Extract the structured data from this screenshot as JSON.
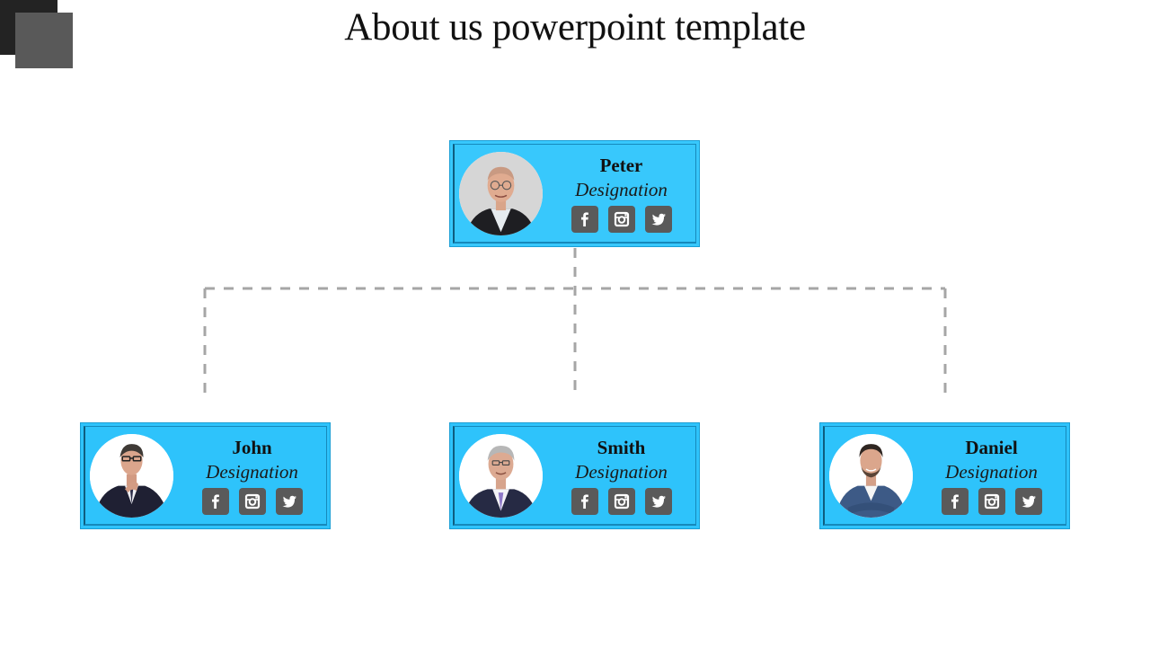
{
  "slide": {
    "title": "About us powerpoint template",
    "colors": {
      "card_fill": "#2ec3fb",
      "card_border": "#1a9fd6",
      "icon_bg": "#5a5a5a",
      "connector": "#a6a6a6",
      "deco_dark": "#232323",
      "deco_light": "#595959"
    }
  },
  "top": {
    "name": "Peter",
    "designation": "Designation",
    "socials": [
      "facebook-icon",
      "instagram-icon",
      "twitter-icon"
    ]
  },
  "members": [
    {
      "name": "John",
      "designation": "Designation",
      "socials": [
        "facebook-icon",
        "instagram-icon",
        "twitter-icon"
      ]
    },
    {
      "name": "Smith",
      "designation": "Designation",
      "socials": [
        "facebook-icon",
        "instagram-icon",
        "twitter-icon"
      ]
    },
    {
      "name": "Daniel",
      "designation": "Designation",
      "socials": [
        "facebook-icon",
        "instagram-icon",
        "twitter-icon"
      ]
    }
  ]
}
